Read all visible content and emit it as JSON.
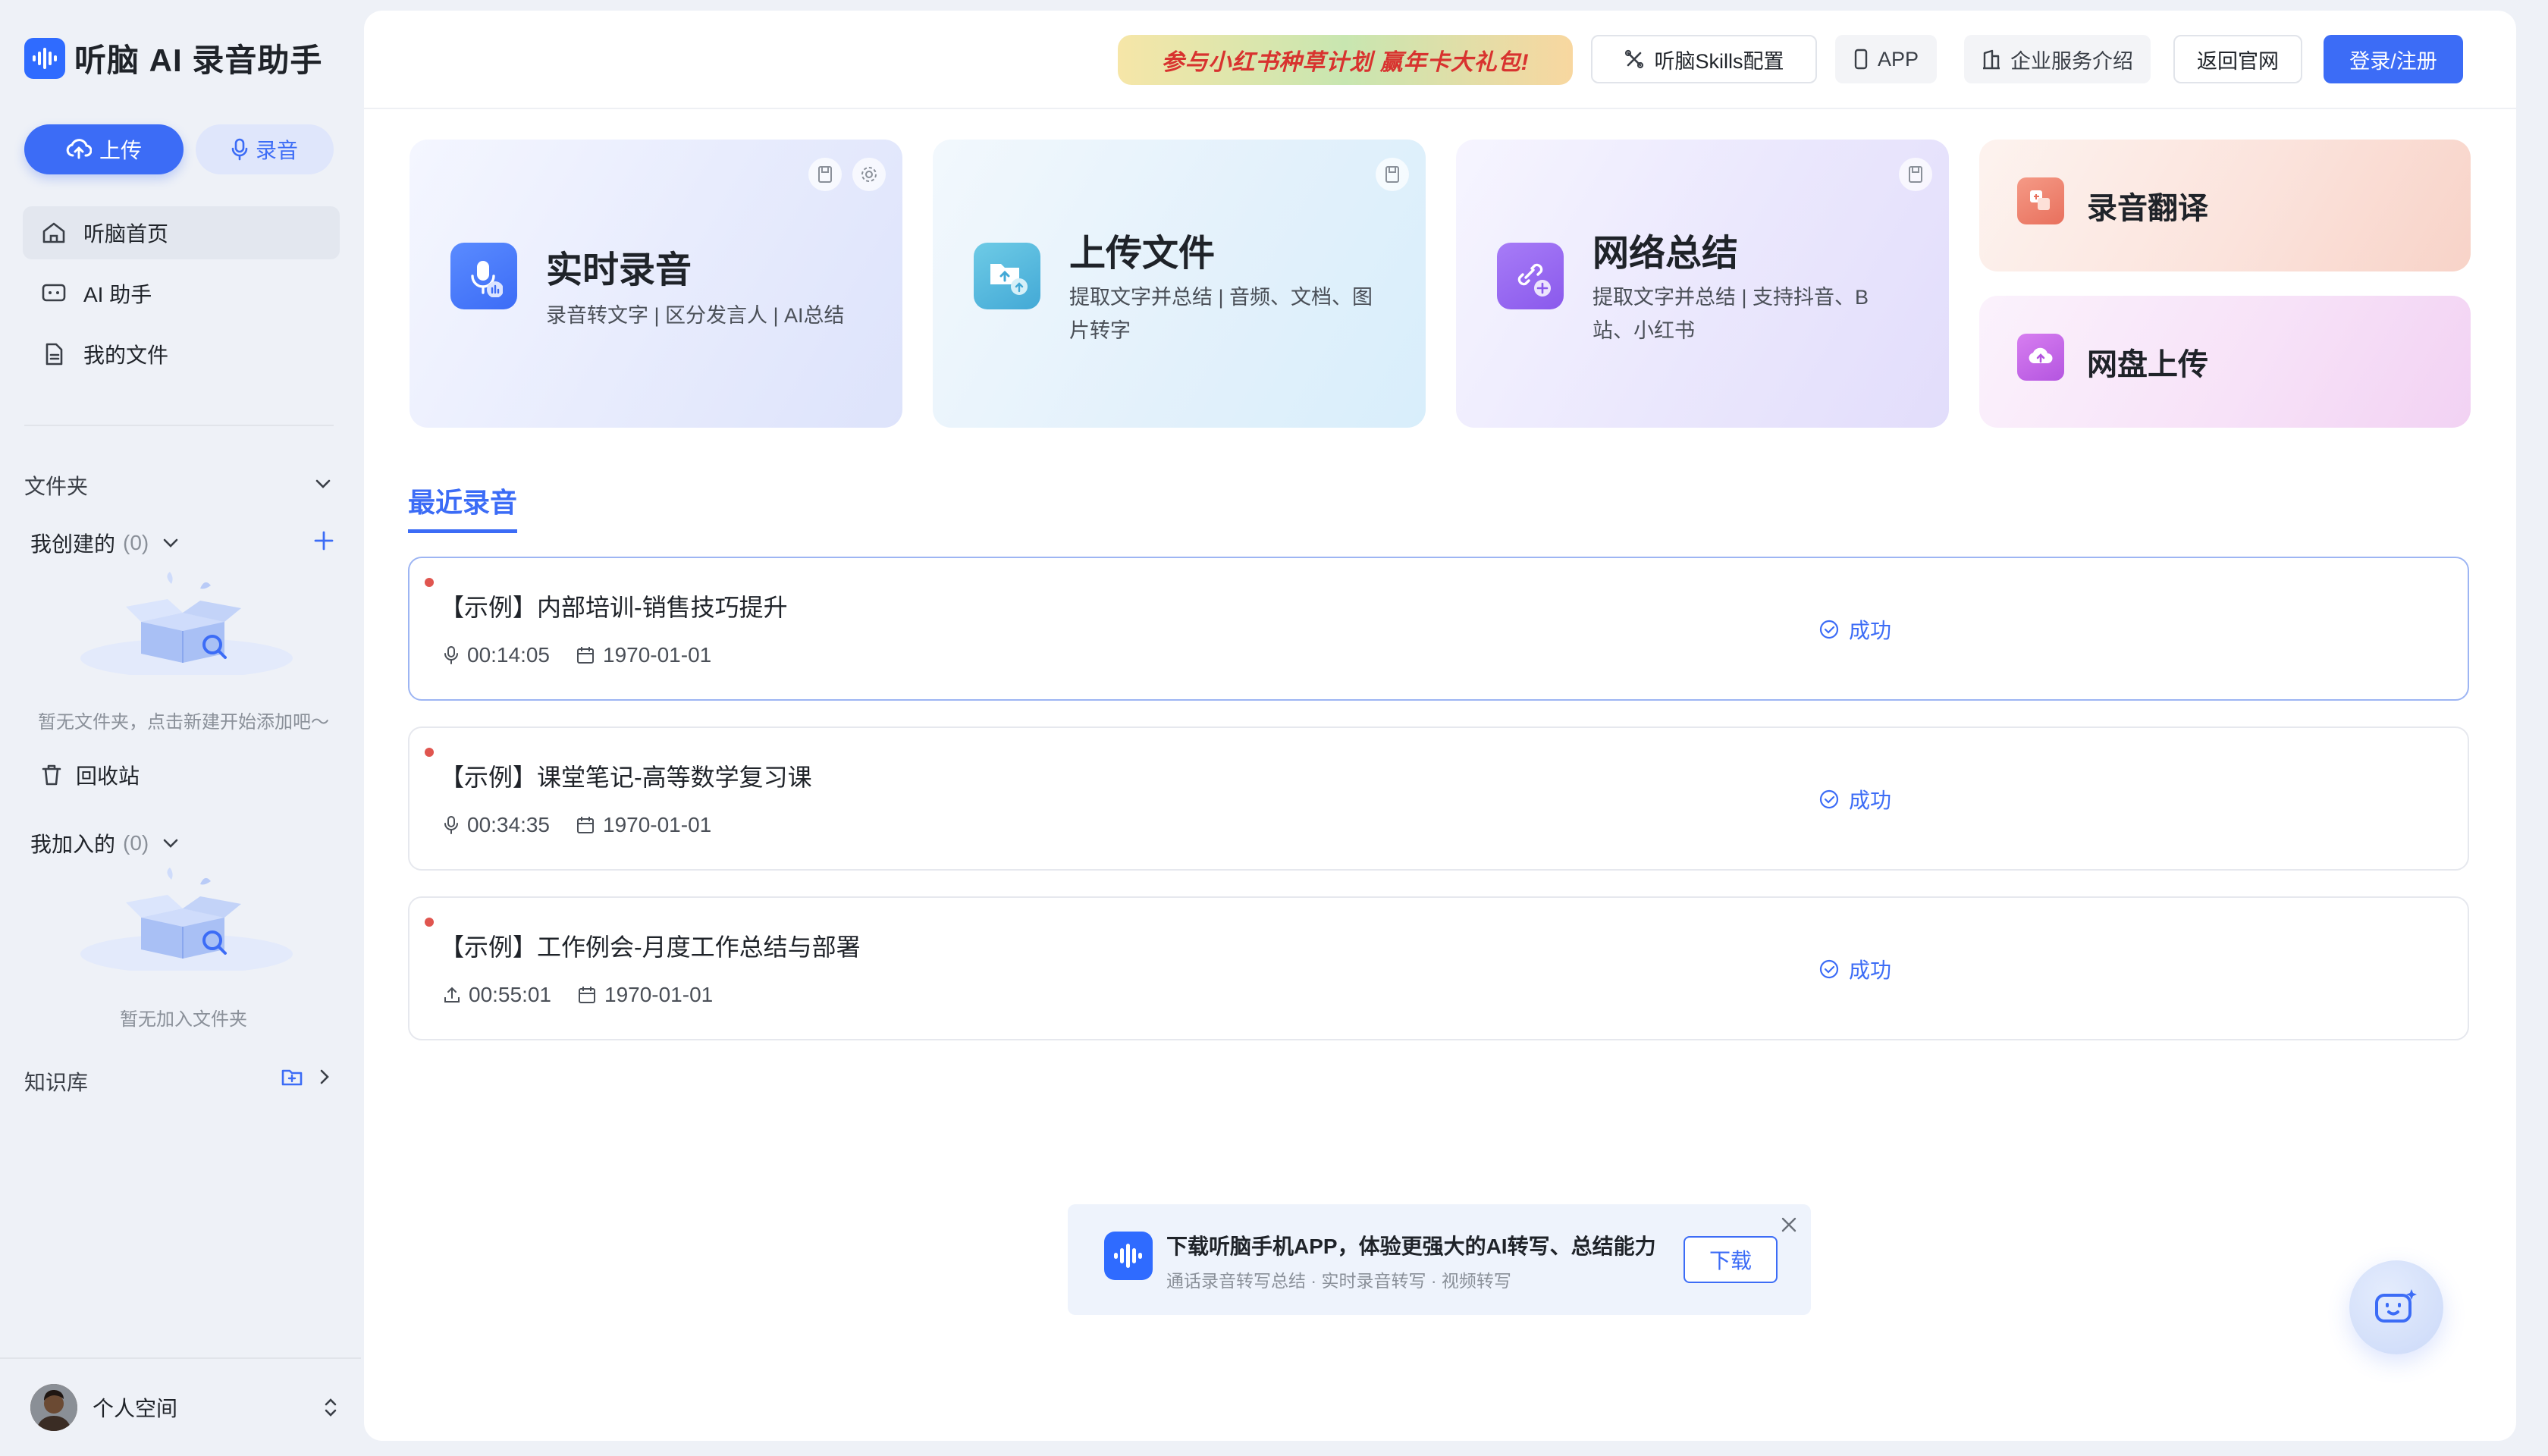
{
  "app": {
    "title": "听脑 AI 录音助手"
  },
  "sidebar": {
    "upload_label": "上传",
    "record_label": "录音",
    "nav": [
      {
        "label": "听脑首页",
        "icon": "home-icon",
        "active": true
      },
      {
        "label": "AI 助手",
        "icon": "ai-assistant-icon",
        "active": false
      },
      {
        "label": "我的文件",
        "icon": "file-icon",
        "active": false
      }
    ],
    "folders_title": "文件夹",
    "created_label": "我创建的",
    "created_count": "(0)",
    "created_empty": "暂无文件夹，点击新建开始添加吧～",
    "recycle_label": "回收站",
    "joined_label": "我加入的",
    "joined_count": "(0)",
    "joined_empty": "暂无加入文件夹",
    "knowledge_label": "知识库",
    "profile_name": "个人空间"
  },
  "topbar": {
    "promo_text": "参与小红书种草计划 赢年卡大礼包!",
    "skills_label": "听脑Skills配置",
    "app_label": "APP",
    "enterprise_label": "企业服务介绍",
    "back_label": "返回官网",
    "login_label": "登录/注册"
  },
  "cards": {
    "realtime": {
      "title": "实时录音",
      "sub": "录音转文字 | 区分发言人 | AI总结"
    },
    "upload": {
      "title": "上传文件",
      "sub1": "提取文字并总结 | 音频、文档、图",
      "sub2": "片转字"
    },
    "web": {
      "title": "网络总结",
      "sub1": "提取文字并总结 | 支持抖音、B",
      "sub2": "站、小红书"
    },
    "translate": {
      "title": "录音翻译"
    },
    "cloud": {
      "title": "网盘上传"
    }
  },
  "recent": {
    "tab_label": "最近录音",
    "items": [
      {
        "title": "【示例】内部培训-销售技巧提升",
        "duration": "00:14:05",
        "date": "1970-01-01",
        "status": "成功",
        "source_icon": "mic-icon"
      },
      {
        "title": "【示例】课堂笔记-高等数学复习课",
        "duration": "00:34:35",
        "date": "1970-01-01",
        "status": "成功",
        "source_icon": "mic-icon"
      },
      {
        "title": "【示例】工作例会-月度工作总结与部署",
        "duration": "00:55:01",
        "date": "1970-01-01",
        "status": "成功",
        "source_icon": "upload-icon"
      }
    ]
  },
  "download": {
    "title": "下载听脑手机APP，体验更强大的AI转写、总结能力",
    "sub": "通话录音转写总结 · 实时录音转写 · 视频转写",
    "button": "下载"
  },
  "colors": {
    "accent": "#3c6cf6",
    "success_text": "#3c6cf6",
    "dot": "#e0554f"
  }
}
